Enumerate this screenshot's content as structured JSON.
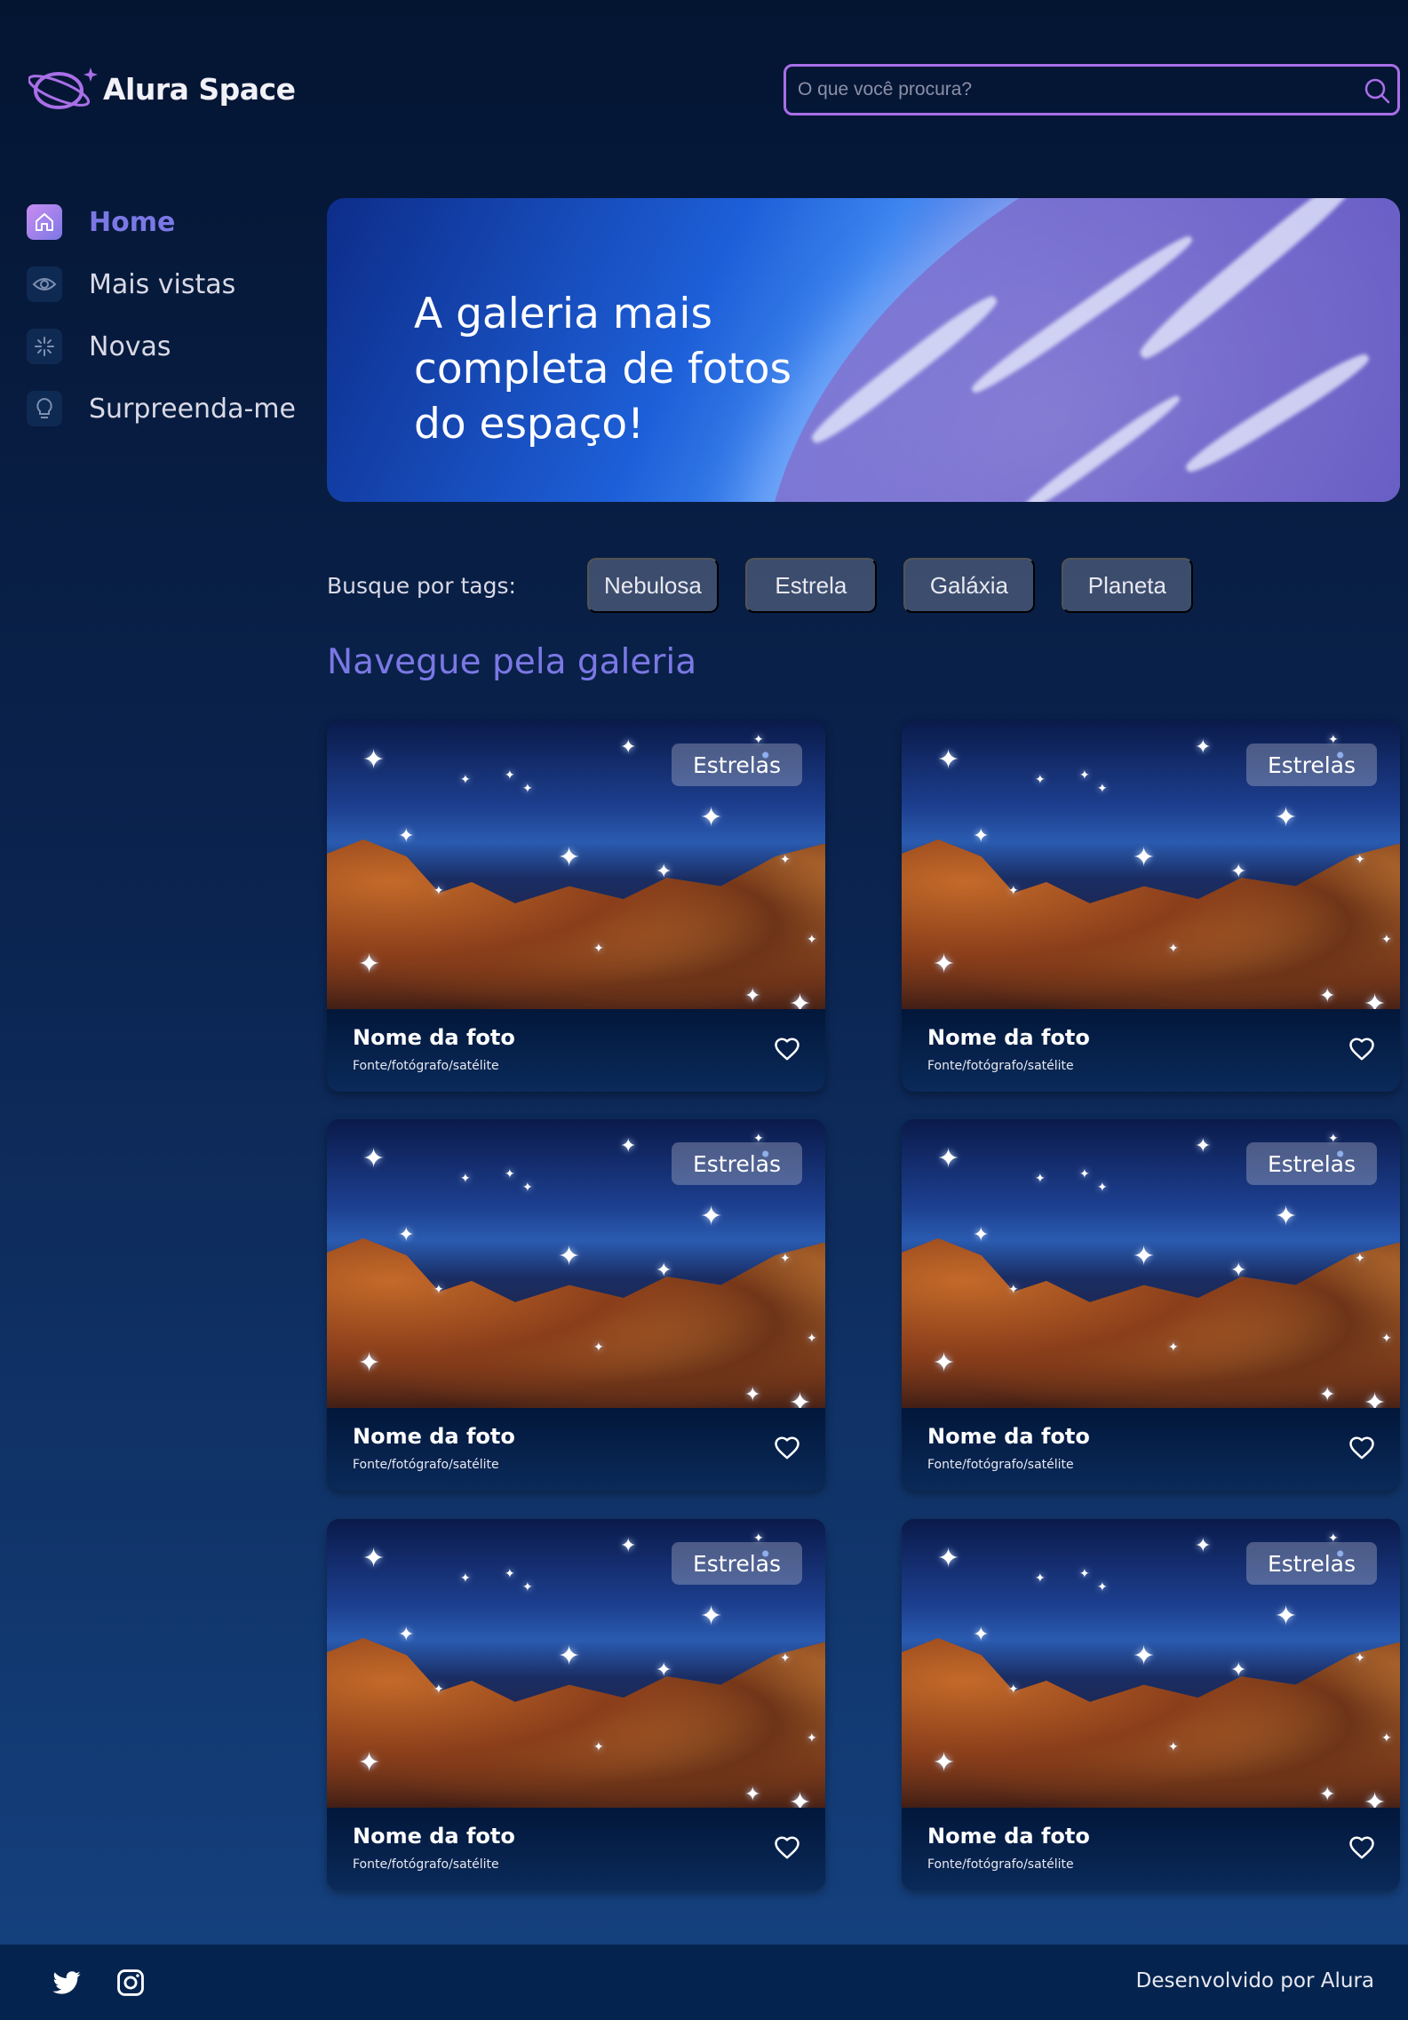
{
  "header": {
    "brand": "Alura Space",
    "search_placeholder": "O que você procura?"
  },
  "sidebar": {
    "items": [
      {
        "label": "Home",
        "icon": "home-icon",
        "active": true
      },
      {
        "label": "Mais vistas",
        "icon": "eye-icon",
        "active": false
      },
      {
        "label": "Novas",
        "icon": "sparkle-icon",
        "active": false
      },
      {
        "label": "Surpreenda-me",
        "icon": "lightbulb-icon",
        "active": false
      }
    ]
  },
  "banner": {
    "title": "A galeria mais completa de fotos do espaço!"
  },
  "tags": {
    "label": "Busque por tags:",
    "items": [
      "Nebulosa",
      "Estrela",
      "Galáxia",
      "Planeta"
    ]
  },
  "gallery": {
    "title": "Navegue pela galeria",
    "cards": [
      {
        "badge": "Estrelas",
        "title": "Nome da foto",
        "source": "Fonte/fotógrafo/satélite"
      },
      {
        "badge": "Estrelas",
        "title": "Nome da foto",
        "source": "Fonte/fotógrafo/satélite"
      },
      {
        "badge": "Estrelas",
        "title": "Nome da foto",
        "source": "Fonte/fotógrafo/satélite"
      },
      {
        "badge": "Estrelas",
        "title": "Nome da foto",
        "source": "Fonte/fotógrafo/satélite"
      },
      {
        "badge": "Estrelas",
        "title": "Nome da foto",
        "source": "Fonte/fotógrafo/satélite"
      },
      {
        "badge": "Estrelas",
        "title": "Nome da foto",
        "source": "Fonte/fotógrafo/satélite"
      }
    ]
  },
  "footer": {
    "social": [
      "twitter-icon",
      "instagram-icon"
    ],
    "credit": "Desenvolvido por Alura"
  },
  "colors": {
    "accent": "#7b78e5",
    "search_border": "#a96fe8",
    "background_top": "#041532",
    "background_bottom": "#154280"
  }
}
